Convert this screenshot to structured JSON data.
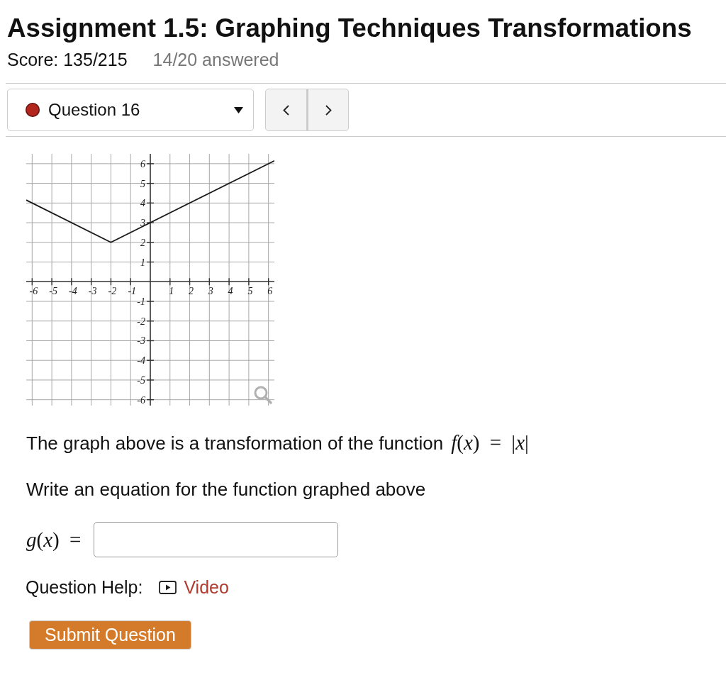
{
  "assignment": {
    "title": "Assignment 1.5: Graphing Techniques Transformations",
    "score": "Score: 135/215",
    "progress": "14/20 answered"
  },
  "question_nav": {
    "current": {
      "label": "Question 16",
      "color": "#b3261e"
    }
  },
  "question": {
    "graph": {
      "chart_data": {
        "type": "line",
        "x": [
          -6.3,
          -2,
          6.3
        ],
        "values": [
          4.15,
          2,
          6.15
        ],
        "xlim": [
          -6.3,
          6.3
        ],
        "ylim": [
          -6.3,
          6.5
        ],
        "xticks": [
          -6,
          -5,
          -4,
          -3,
          -2,
          -1,
          1,
          2,
          3,
          4,
          5,
          6
        ],
        "yticks": [
          -6,
          -5,
          -4,
          -3,
          -2,
          -1,
          1,
          2,
          3,
          4,
          5,
          6
        ],
        "grid": true
      }
    },
    "prompt": "The graph above is a transformation of the function",
    "formula": "*f*(*x*) = |*x*|",
    "instruction": "Write an equation for the function graphed above",
    "answer": {
      "label": "*g*(*x*) ="
    },
    "help": {
      "label": "Question Help:",
      "link": "Video"
    },
    "submit": "Submit Question"
  }
}
